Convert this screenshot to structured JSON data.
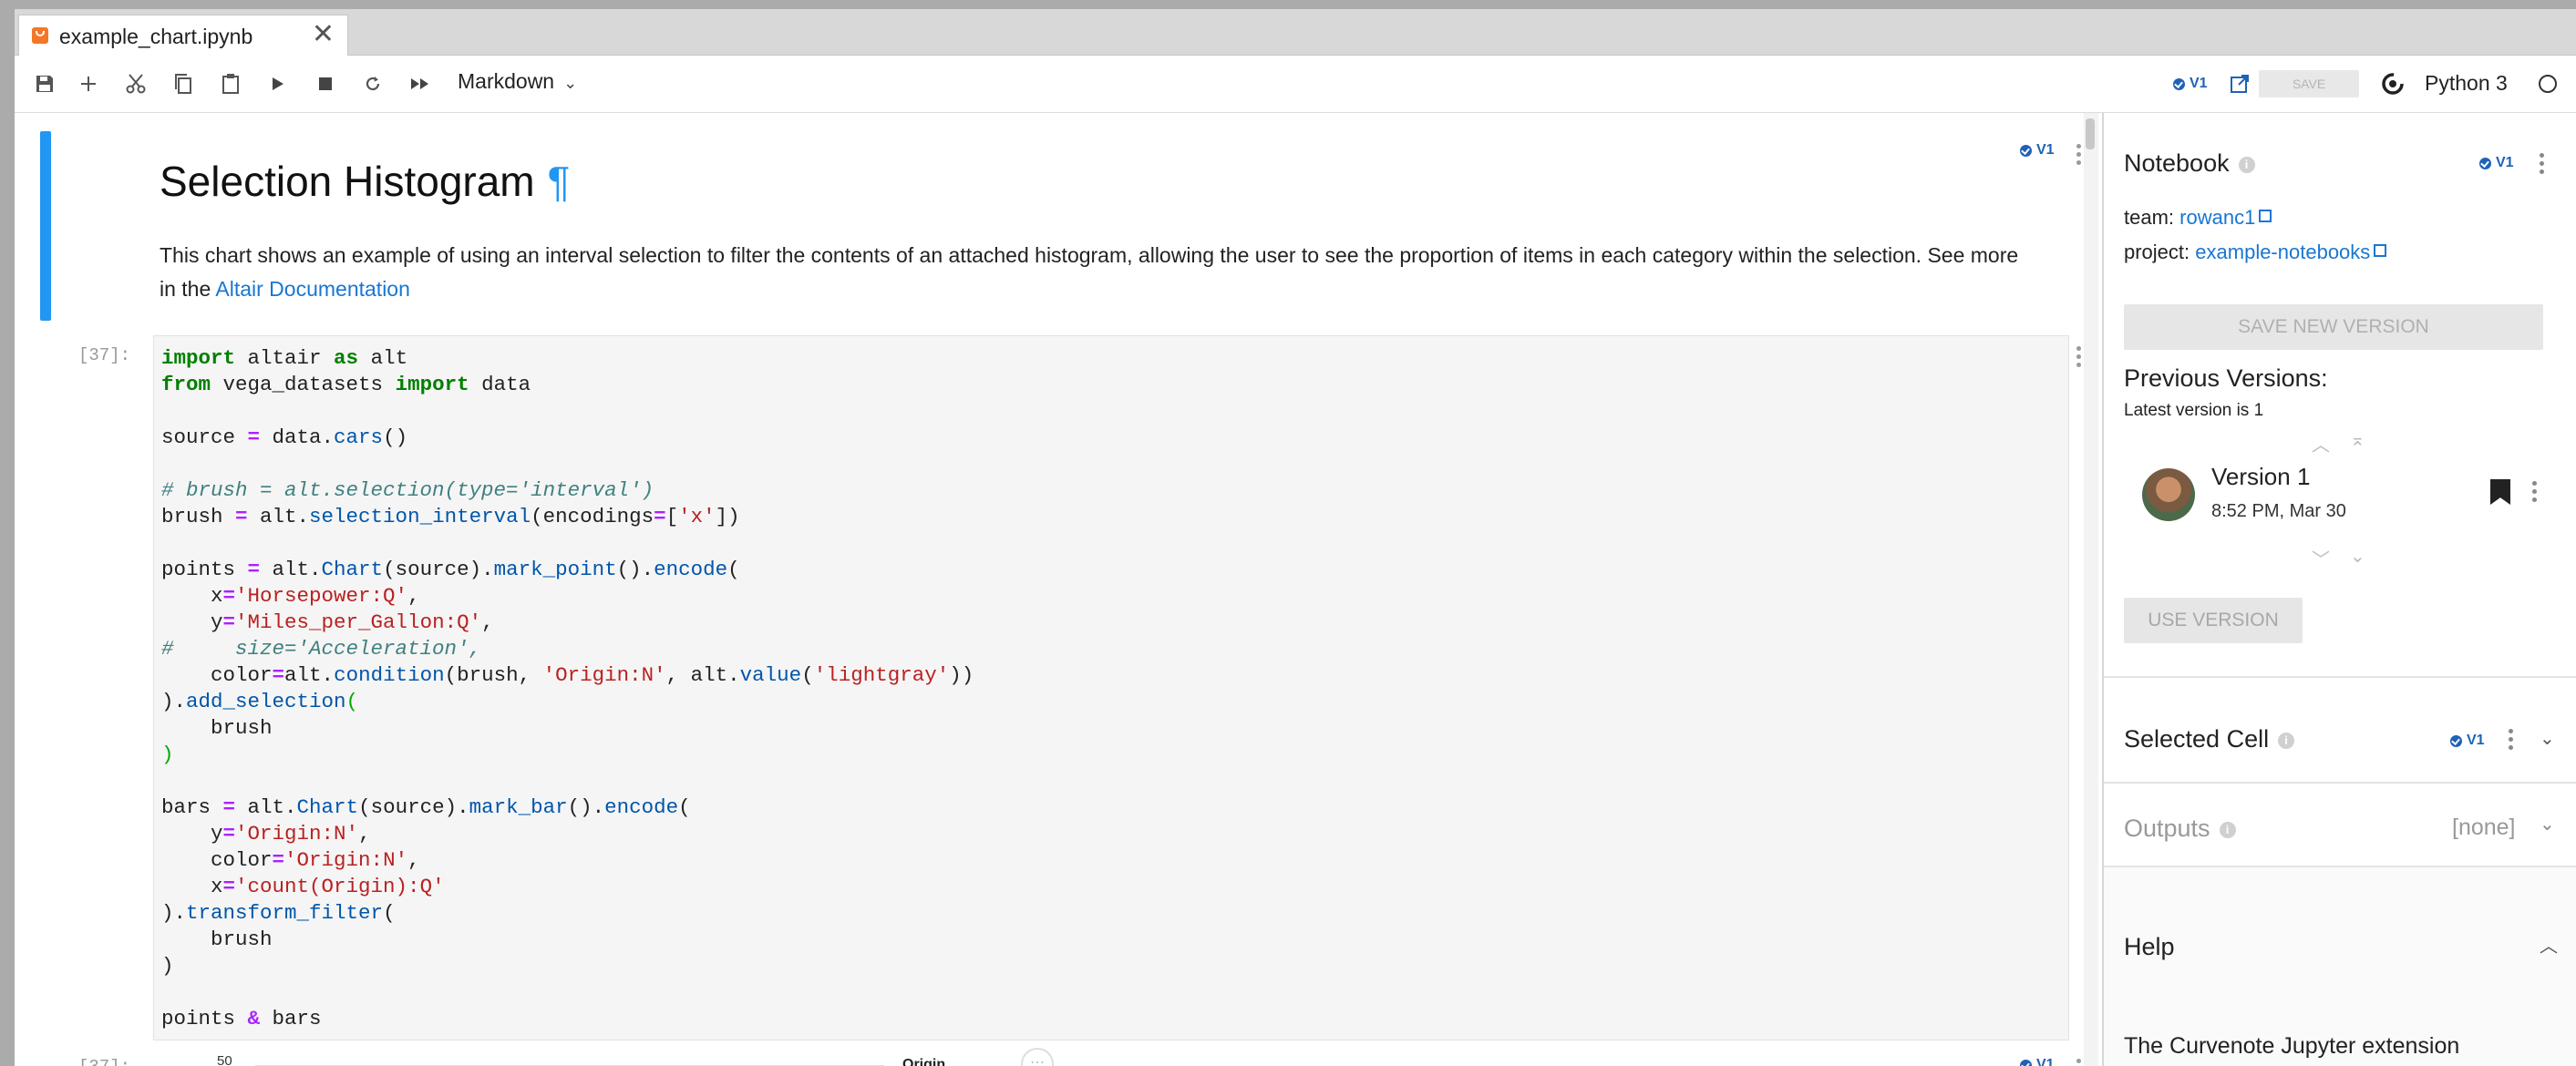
{
  "tab": {
    "title": "example_chart.ipynb",
    "close": "✕"
  },
  "toolbar": {
    "cell_type": "Markdown",
    "version_badge": "V1",
    "save_label": "SAVE",
    "kernel": "Python 3"
  },
  "notebook": {
    "md_cell": {
      "title": "Selection Histogram",
      "anchor": "¶",
      "para_text": "This chart shows an example of using an interval selection to filter the contents of an attached histogram, allowing the user to see the proportion of items in each category within the selection. See more in the ",
      "link_text": "Altair Documentation",
      "badge": "V1"
    },
    "code_cell": {
      "prompt": "[37]:",
      "badge": "V1"
    },
    "output_cell": {
      "prompt": "[37]:",
      "axis_tick": "50",
      "legend_title": "Origin",
      "badge": "V1"
    }
  },
  "panel": {
    "notebook_heading": "Notebook",
    "notebook_badge": "V1",
    "team_label": "team:",
    "team_value": "rowanc1",
    "project_label": "project:",
    "project_value": "example-notebooks",
    "save_new_version": "SAVE NEW VERSION",
    "previous_versions": "Previous Versions:",
    "latest_version": "Latest version is 1",
    "version_name": "Version 1",
    "version_time": "8:52 PM, Mar 30",
    "use_version": "USE VERSION",
    "selected_cell": "Selected Cell",
    "selected_badge": "V1",
    "outputs": "Outputs",
    "outputs_value": "[none]",
    "help": "Help",
    "help_text": "The Curvenote Jupyter extension"
  },
  "colors": {
    "accent": "#2196f3",
    "link": "#1976d2",
    "badge": "#1f62b6"
  }
}
